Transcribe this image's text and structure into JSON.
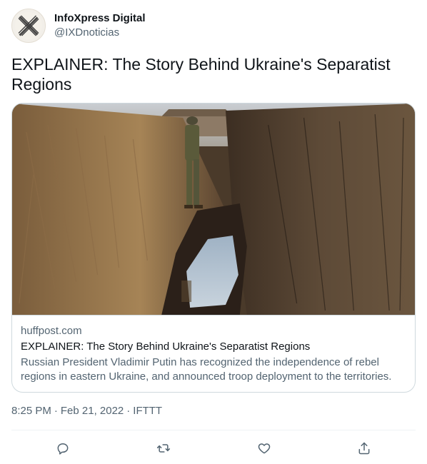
{
  "author": {
    "display_name": "InfoXpress Digital",
    "handle": "@IXDnoticias",
    "avatar_icon": "ix-logo-icon"
  },
  "tweet": {
    "text": "EXPLAINER: The Story Behind Ukraine's Separatist Regions"
  },
  "card": {
    "image_icon": "trench-photo",
    "domain": "huffpost.com",
    "title": "EXPLAINER: The Story Behind Ukraine's Separatist Regions",
    "description": "Russian President Vladimir Putin has recognized the independence of rebel regions in eastern Ukraine, and announced troop deployment to the territories."
  },
  "meta": {
    "time": "8:25 PM",
    "date": "Feb 21, 2022",
    "separator": "·",
    "source": "IFTTT"
  },
  "actions": [
    {
      "name": "reply",
      "icon": "reply-icon"
    },
    {
      "name": "retweet",
      "icon": "retweet-icon"
    },
    {
      "name": "like",
      "icon": "heart-icon"
    },
    {
      "name": "share",
      "icon": "share-icon"
    }
  ],
  "colors": {
    "primary_text": "#0f1419",
    "secondary_text": "#536471",
    "border": "#cfd9de",
    "divider": "#eff3f4"
  }
}
